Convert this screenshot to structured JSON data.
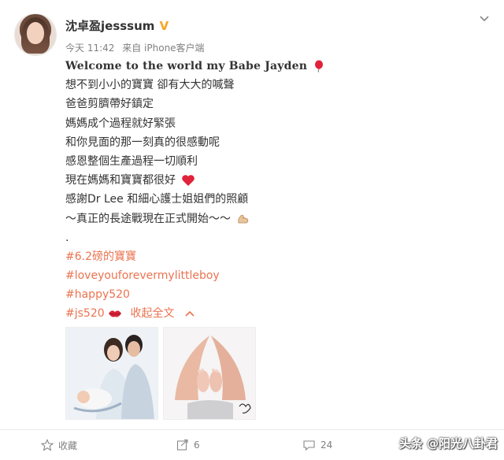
{
  "post": {
    "username": "沈卓盈jesssum",
    "time": "今天 11:42",
    "source": "来自 iPhone客户端",
    "title_line": "Welcome to the world my  Babe Jayden",
    "lines": [
      "想不到小小的寶寶 卻有大大的喊聲",
      "爸爸剪臍帶好鎮定",
      "媽媽成个過程就好緊張",
      "和你見面的那一刻真的很感動呢",
      "感恩整個生產過程一切順利",
      "現在媽媽和寶寶都很好",
      "感謝Dr Lee 和細心護士姐姐們的照顧",
      "～真正的長途戰現在正式開始～～",
      "."
    ],
    "hashtags": [
      "#6.2磅的寶寶",
      "#loveyouforevermylittleboy",
      "#happy520",
      "#js520"
    ],
    "collapse_label": "收起全文",
    "images": [
      {
        "icon": "family-photo"
      },
      {
        "icon": "baby-feet-photo"
      }
    ]
  },
  "actions": {
    "favorite_label": "收藏",
    "repost_count": "6",
    "comment_count": "24"
  },
  "watermark": "头条 @阳光八卦君",
  "colors": {
    "link": "#eb7350",
    "text": "#333333",
    "meta": "#808080",
    "heart": "#e0223a",
    "vip": "#f5a623"
  }
}
